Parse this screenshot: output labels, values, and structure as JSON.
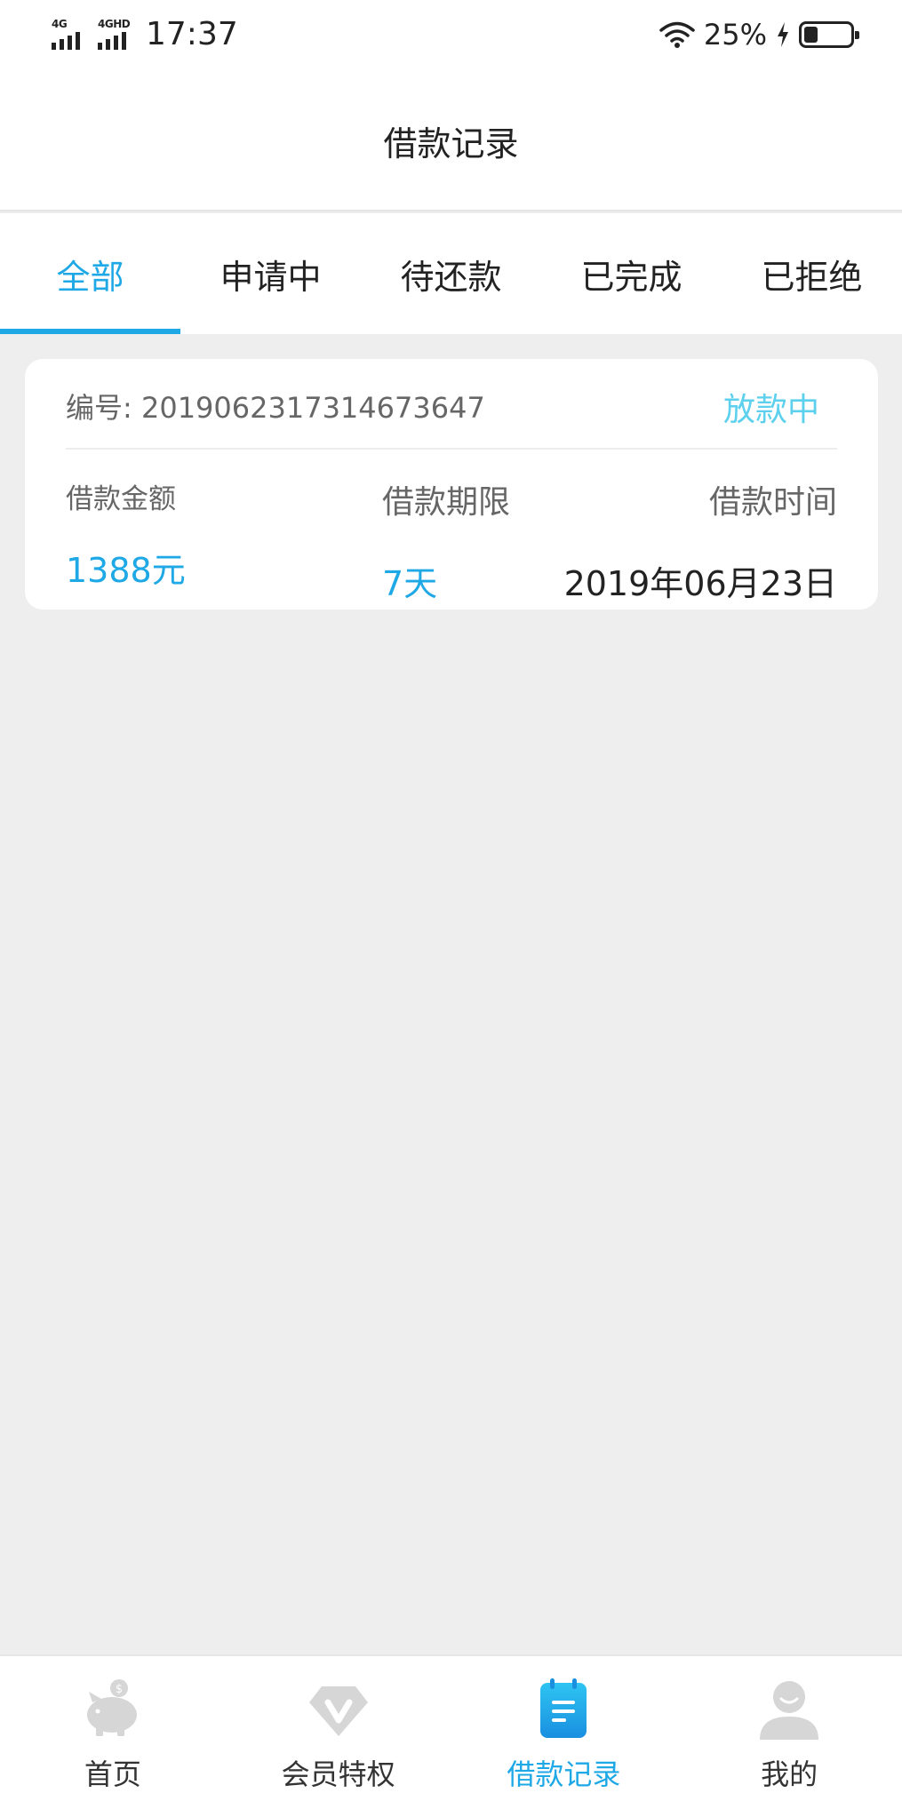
{
  "status_bar": {
    "network_1": "4G",
    "network_2": "4GHD",
    "time": "17:37",
    "battery": "25%",
    "icons": [
      "signal-icon",
      "wifi-icon",
      "charging-icon",
      "battery-icon"
    ]
  },
  "header": {
    "title": "借款记录"
  },
  "tabs": [
    {
      "label": "全部",
      "active": true
    },
    {
      "label": "申请中",
      "active": false
    },
    {
      "label": "待还款",
      "active": false
    },
    {
      "label": "已完成",
      "active": false
    },
    {
      "label": "已拒绝",
      "active": false
    }
  ],
  "records": [
    {
      "id_label": "编号:",
      "id_value": "2019062317314673647",
      "status": "放款中",
      "amount_label": "借款金额",
      "amount_value": "1388元",
      "term_label": "借款期限",
      "term_value": "7天",
      "time_label": "借款时间",
      "time_value": "2019年06月23日"
    }
  ],
  "bottom_nav": [
    {
      "label": "首页",
      "icon": "piggy-bank-icon",
      "active": false
    },
    {
      "label": "会员特权",
      "icon": "diamond-v-icon",
      "active": false
    },
    {
      "label": "借款记录",
      "icon": "notepad-icon",
      "active": true
    },
    {
      "label": "我的",
      "icon": "user-icon",
      "active": false
    }
  ],
  "colors": {
    "accent": "#1ea8e6",
    "status_text": "#5cd0ec",
    "page_background": "#eeeeee",
    "inactive_icon": "#d6d6d6"
  }
}
